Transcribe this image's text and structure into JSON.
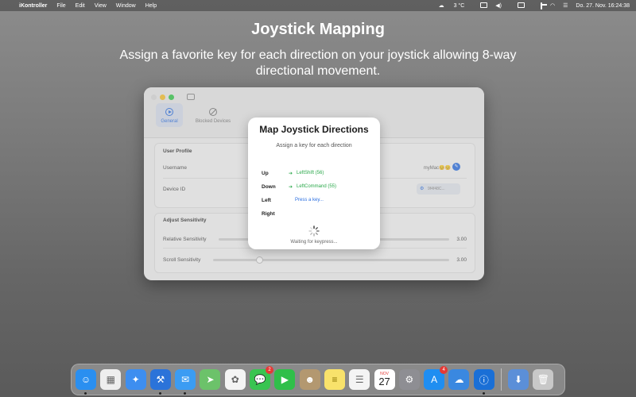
{
  "menubar": {
    "apple": "",
    "app_name": "iKontroller",
    "menus": [
      "File",
      "Edit",
      "View",
      "Window",
      "Help"
    ],
    "weather": "3 °C",
    "datetime": "Do. 27. Nov.  16:24:38"
  },
  "hero": {
    "title": "Joystick Mapping",
    "subtitle": "Assign a favorite key for each direction on your joystick allowing 8-way directional movement."
  },
  "window": {
    "tabs": [
      {
        "label": "General",
        "icon": "play-circle-icon"
      },
      {
        "label": "Blocked Devices",
        "icon": "prohibited-icon"
      }
    ],
    "user_profile": {
      "title": "User Profile",
      "username_label": "Username",
      "username_value": "myMac😊😊",
      "device_id_label": "Device ID",
      "device_id_value": "9f4f48C..."
    },
    "sensitivity": {
      "title": "Adjust Sensitivity",
      "relative_label": "Relative Sensitivity",
      "relative_value": "3.00",
      "relative_level": 1.0,
      "scroll_label": "Scroll Sensitivity",
      "scroll_value": "3.00",
      "scroll_level": 0.2
    }
  },
  "sheet": {
    "title": "Map Joystick Directions",
    "subtitle": "Assign a key for each direction",
    "directions": [
      {
        "name": "Up",
        "arrow": "➔",
        "value": "LeftShift (56)"
      },
      {
        "name": "Down",
        "arrow": "➔",
        "value": "LeftCommand (55)"
      },
      {
        "name": "Left",
        "arrow": "",
        "value": "Press a key..."
      },
      {
        "name": "Right",
        "arrow": "",
        "value": ""
      }
    ],
    "waiting": "Waiting for keypress..."
  },
  "dock": {
    "calendar_month": "NOV",
    "calendar_day": "27",
    "messages_badge": "2",
    "appstore_badge": "4",
    "apps": [
      {
        "name": "finder-icon",
        "color": "#2a8ff0",
        "glyph": "☺",
        "running": true
      },
      {
        "name": "launchpad-icon",
        "color": "#eeeeee",
        "glyph": "▦",
        "running": false
      },
      {
        "name": "safari-icon",
        "color": "#3d8ef0",
        "glyph": "✦",
        "running": false
      },
      {
        "name": "xcode-icon",
        "color": "#2b73d9",
        "glyph": "⚒",
        "running": true
      },
      {
        "name": "mail-icon",
        "color": "#3b9cf3",
        "glyph": "✉",
        "running": true
      },
      {
        "name": "maps-icon",
        "color": "#6cc26a",
        "glyph": "➤",
        "running": false
      },
      {
        "name": "photos-icon",
        "color": "#f4f4f4",
        "glyph": "✿",
        "running": false
      },
      {
        "name": "messages-icon",
        "color": "#39c451",
        "glyph": "💬",
        "running": false
      },
      {
        "name": "facetime-icon",
        "color": "#2fbf4a",
        "glyph": "▶",
        "running": false
      },
      {
        "name": "contacts-icon",
        "color": "#b39870",
        "glyph": "☻",
        "running": false
      },
      {
        "name": "notes-icon",
        "color": "#f8e26b",
        "glyph": "≡",
        "running": false
      },
      {
        "name": "reminders-icon",
        "color": "#f4f4f4",
        "glyph": "☰",
        "running": false
      },
      {
        "name": "calendar-icon",
        "color": "#ffffff",
        "glyph": "",
        "running": false
      },
      {
        "name": "system-settings-icon",
        "color": "#8e8e93",
        "glyph": "⚙",
        "running": false
      },
      {
        "name": "app-store-icon",
        "color": "#1f8ef1",
        "glyph": "A",
        "running": false
      },
      {
        "name": "weather-icon",
        "color": "#3a88e0",
        "glyph": "☁",
        "running": false
      },
      {
        "name": "ikontroller-icon",
        "color": "#1a6fd6",
        "glyph": "ⓘ",
        "running": true
      }
    ],
    "extras": [
      {
        "name": "downloads-stack-icon",
        "color": "#5b8fd8",
        "glyph": "⬇",
        "running": false
      },
      {
        "name": "trash-icon",
        "color": "#c8c8c8",
        "glyph": "🗑",
        "running": false
      }
    ]
  }
}
